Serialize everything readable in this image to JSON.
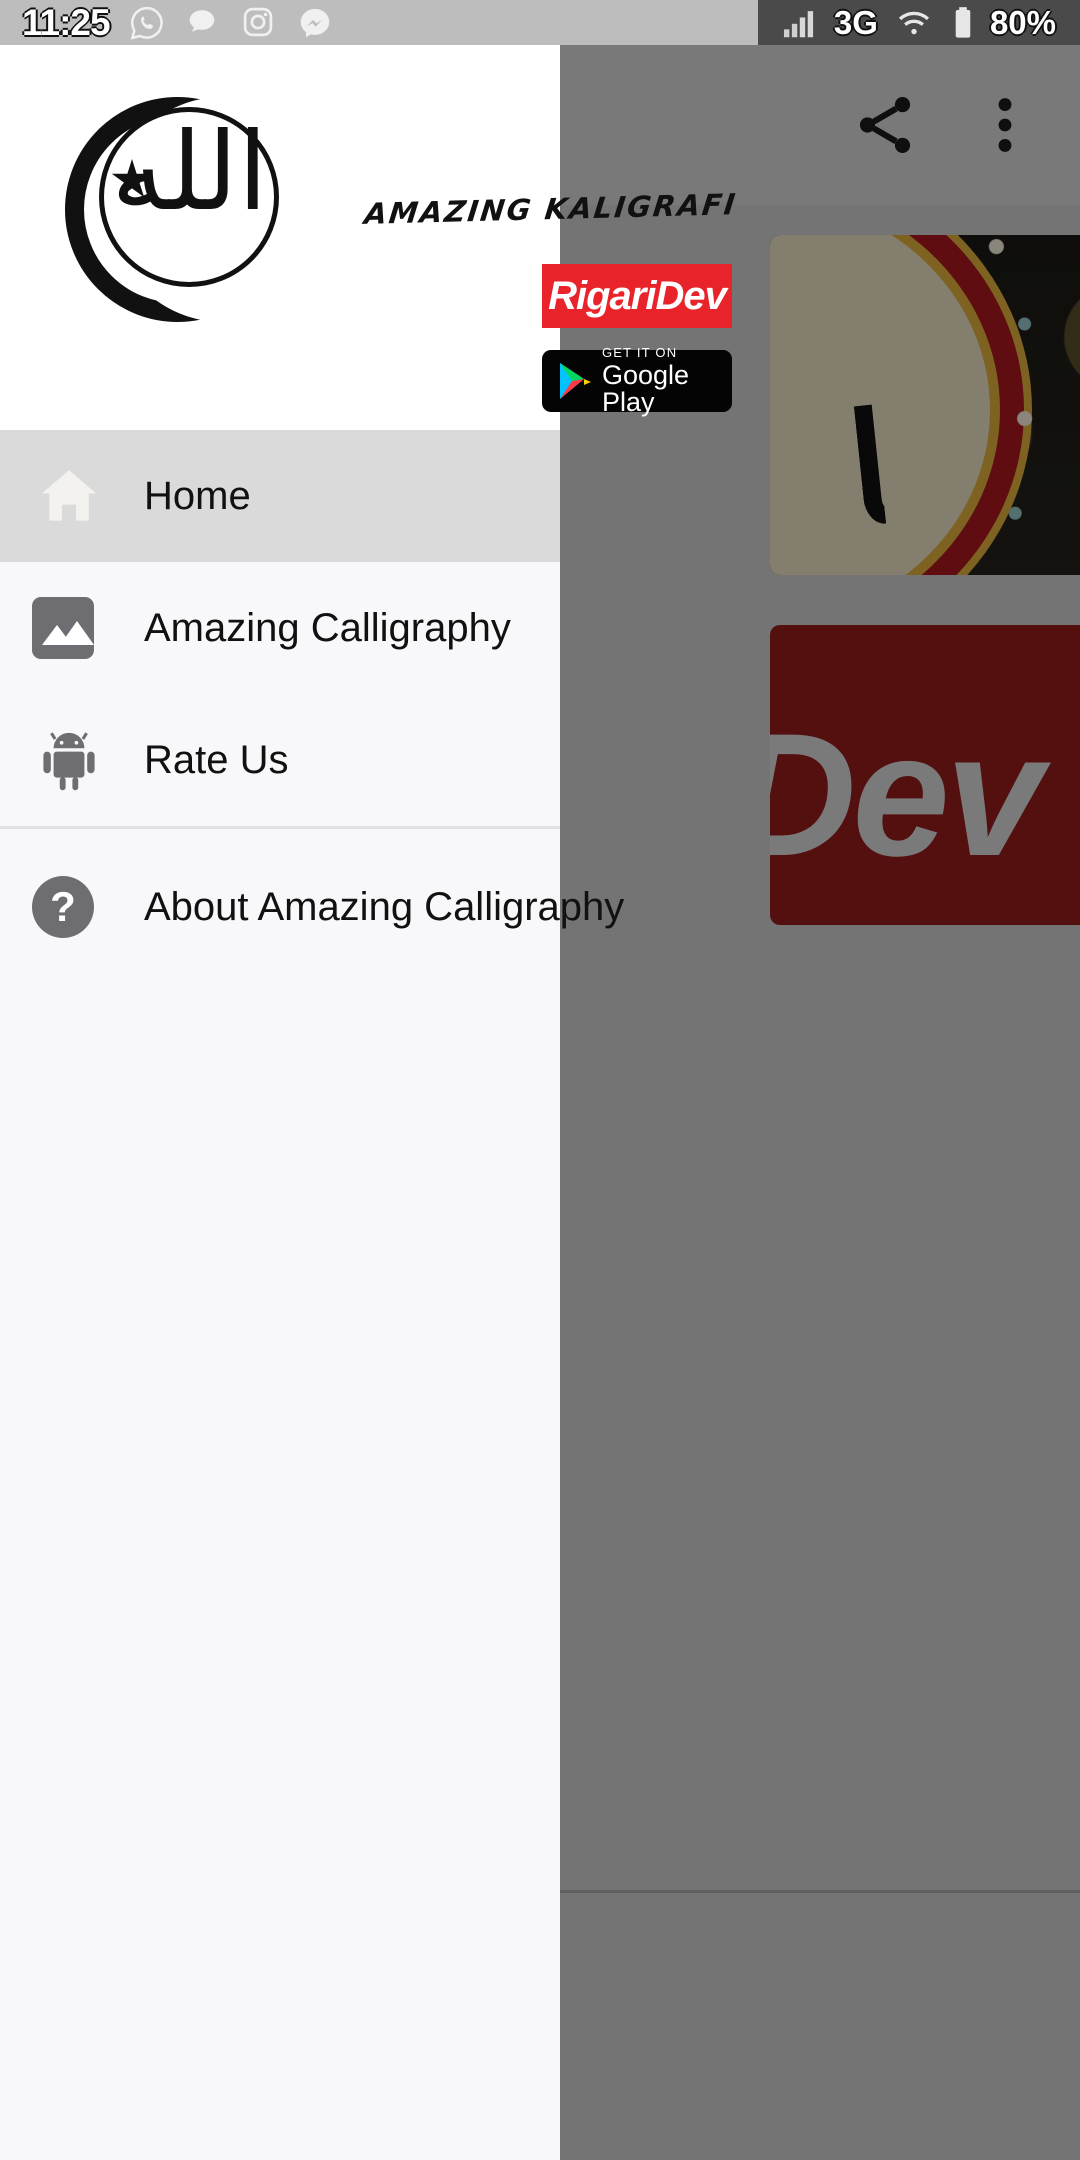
{
  "status_bar": {
    "clock": "11:25",
    "left_icons": [
      "whatsapp-icon",
      "messages-icon",
      "instagram-icon",
      "messenger-icon"
    ],
    "network_label": "3G",
    "battery_label": "80%",
    "right_icons": [
      "signal-icon",
      "wifi-icon",
      "battery-icon"
    ]
  },
  "app_bar": {
    "share_icon": "share-icon",
    "overflow_icon": "more-vert-icon"
  },
  "drawer": {
    "header": {
      "logo_icon": "allah-crescent-logo",
      "logo_glyph": "الله",
      "title": "AMAZING KALIGRAFI",
      "developer_badge": "RigariDev",
      "google_play": {
        "small_text": "GET IT ON",
        "big_text": "Google Play"
      }
    },
    "menu": [
      {
        "label": "Home",
        "icon": "home-icon",
        "selected": true
      },
      {
        "label": "Amazing Calligraphy",
        "icon": "image-icon",
        "selected": false
      },
      {
        "label": "Rate Us",
        "icon": "android-icon",
        "selected": false
      },
      {
        "label": "About Amazing Calligraphy",
        "icon": "help-circle-icon",
        "selected": false
      }
    ]
  },
  "content": {
    "card_1_alt": "calligraphy-artwork-dark-floral",
    "card_2_text": "Dev"
  },
  "colors": {
    "drawer_bg": "#f8f8fa",
    "drawer_header_bg": "#ffffff",
    "selected_row": "#dadada",
    "brand_red": "#e8232a",
    "status_bar_bg": "#bdbdbd",
    "status_bar_right_bg": "#4a4a4a",
    "scrim": "rgba(0,0,0,0.42)"
  }
}
